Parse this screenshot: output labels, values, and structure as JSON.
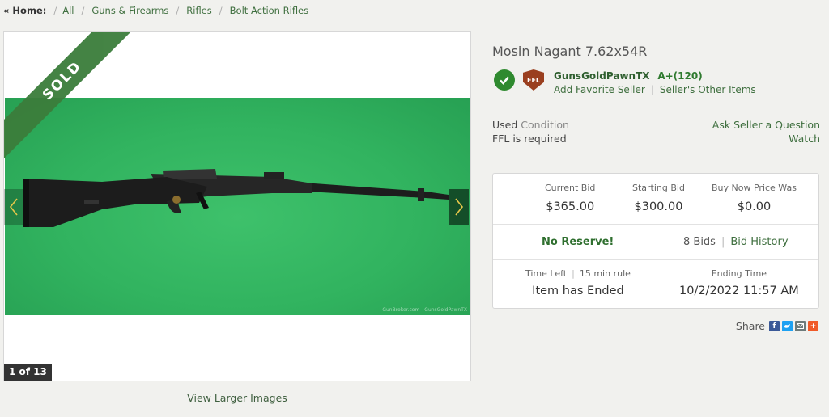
{
  "breadcrumb": {
    "home": "« Home:",
    "items": [
      "All",
      "Guns & Firearms",
      "Rifles",
      "Bolt Action Rifles"
    ]
  },
  "gallery": {
    "banner": "SOLD",
    "counter": "1 of 13",
    "watermark": "GunBroker.com - GunsGoldPawnTX",
    "view_larger": "View Larger Images"
  },
  "listing": {
    "title": "Mosin Nagant 7.62x54R",
    "condition_value": "Used",
    "condition_label": "Condition",
    "ffl_note": "FFL is required"
  },
  "seller": {
    "ffl_badge": "FFL",
    "name": "GunsGoldPawnTX",
    "rating": "A+(120)",
    "add_favorite": "Add Favorite Seller",
    "other_items": "Seller's Other Items"
  },
  "actions": {
    "ask": "Ask Seller a Question",
    "watch": "Watch"
  },
  "bid": {
    "current_label": "Current Bid",
    "current_value": "$365.00",
    "starting_label": "Starting Bid",
    "starting_value": "$300.00",
    "buynow_label": "Buy Now Price Was",
    "buynow_value": "$0.00",
    "no_reserve": "No Reserve!",
    "bids": "8 Bids",
    "history": "Bid History",
    "time_left_label": "Time Left",
    "rule": "15 min rule",
    "time_left_value": "Item has Ended",
    "ending_label": "Ending Time",
    "ending_value": "10/2/2022 11:57 AM"
  },
  "share": {
    "label": "Share",
    "icons": [
      "facebook-icon",
      "twitter-icon",
      "email-icon",
      "more-icon"
    ],
    "colors": [
      "#3b5998",
      "#1da1f2",
      "#6d7b7b",
      "#f05a28"
    ]
  }
}
